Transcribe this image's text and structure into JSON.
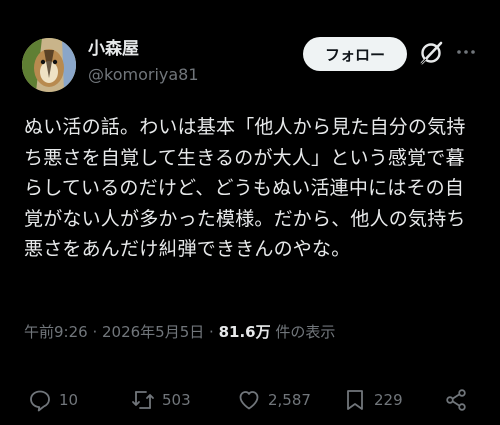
{
  "author": {
    "name": "小森屋",
    "handle": "@komoriya81"
  },
  "header": {
    "follow_label": "フォロー"
  },
  "post": {
    "text": "ぬい活の話。わいは基本「他人から見た自分の気持ち悪さを自覚して生きるのが大人」という感覚で暮らしているのだけど、どうもぬい活連中にはその自覚がない人が多かった模様。だから、他人の気持ち悪さをあんだけ糾弾でききんのやな。"
  },
  "meta": {
    "time": "午前9:26",
    "separator1": " · ",
    "date": "2026年5月5日",
    "separator2": " · ",
    "views": "81.6万",
    "views_label": " 件の表示"
  },
  "actions": {
    "replies": "10",
    "reposts": "503",
    "likes": "2,587",
    "bookmarks": "229"
  },
  "icons": {
    "avatar": "chipmunk-avatar",
    "grok": "grok-icon",
    "more": "more-icon",
    "reply": "reply-icon",
    "repost": "repost-icon",
    "like": "heart-icon",
    "bookmark": "bookmark-icon",
    "share": "share-icon"
  }
}
